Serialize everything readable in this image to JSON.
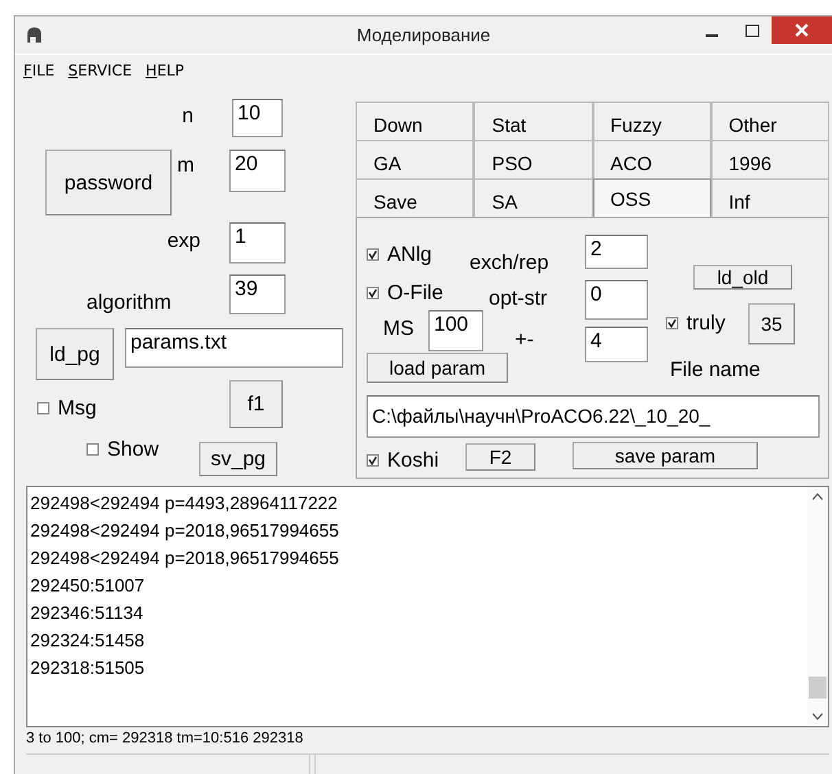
{
  "window": {
    "title": "Моделирование"
  },
  "menu": [
    {
      "label": "FILE"
    },
    {
      "label": "SERVICE"
    },
    {
      "label": "HELP"
    }
  ],
  "left_panel": {
    "password_button": "password",
    "fields": [
      {
        "label": "n",
        "value": "10"
      },
      {
        "label": "m",
        "value": "20"
      },
      {
        "label": "exp",
        "value": "1"
      },
      {
        "label": "algorithm",
        "value": "39"
      }
    ],
    "load_button": "ld_pg",
    "file_field": "params.txt",
    "checkboxes": [
      {
        "label": "Msg",
        "checked": false
      },
      {
        "label": "Show",
        "checked": false
      }
    ],
    "f1_button": "f1",
    "save_button": "sv_pg"
  },
  "tabs": [
    {
      "label": "Down",
      "selected": false
    },
    {
      "label": "Stat",
      "selected": false
    },
    {
      "label": "Fuzzy",
      "selected": false
    },
    {
      "label": "Other",
      "selected": false
    },
    {
      "label": "GA",
      "selected": false
    },
    {
      "label": "PSO",
      "selected": false
    },
    {
      "label": "ACO",
      "selected": false
    },
    {
      "label": "1996",
      "selected": false
    },
    {
      "label": "Save",
      "selected": false
    },
    {
      "label": "SA",
      "selected": false
    },
    {
      "label": "OSS",
      "selected": true
    },
    {
      "label": "Inf",
      "selected": false
    }
  ],
  "oss_page": {
    "checkboxes": [
      {
        "label": "ANlg",
        "checked": true
      },
      {
        "label": "O-File",
        "checked": true
      },
      {
        "label": "truly",
        "checked": true
      },
      {
        "label": "Koshi",
        "checked": true
      }
    ],
    "fields": [
      {
        "label": "exch/rep",
        "value": "2"
      },
      {
        "label": "opt-str",
        "value": "0"
      },
      {
        "label": "+-",
        "value": "4"
      },
      {
        "label": "MS",
        "value": "100"
      }
    ],
    "buttons": [
      "ld_old",
      "35",
      "load param",
      "F2",
      "save param"
    ],
    "file_name_label": "File name",
    "path": "C:\\файлы\\научн\\ProACO6.22\\_10_20_"
  },
  "log": [
    "292498<292494 p=4493,28964117222",
    "292498<292494 p=2018,96517994655",
    "292498<292494 p=2018,96517994655",
    "292450:51007",
    "292346:51134",
    "292324:51458",
    "292318:51505"
  ],
  "status": "3 to 100; cm= 292318 tm=10:516 292318"
}
